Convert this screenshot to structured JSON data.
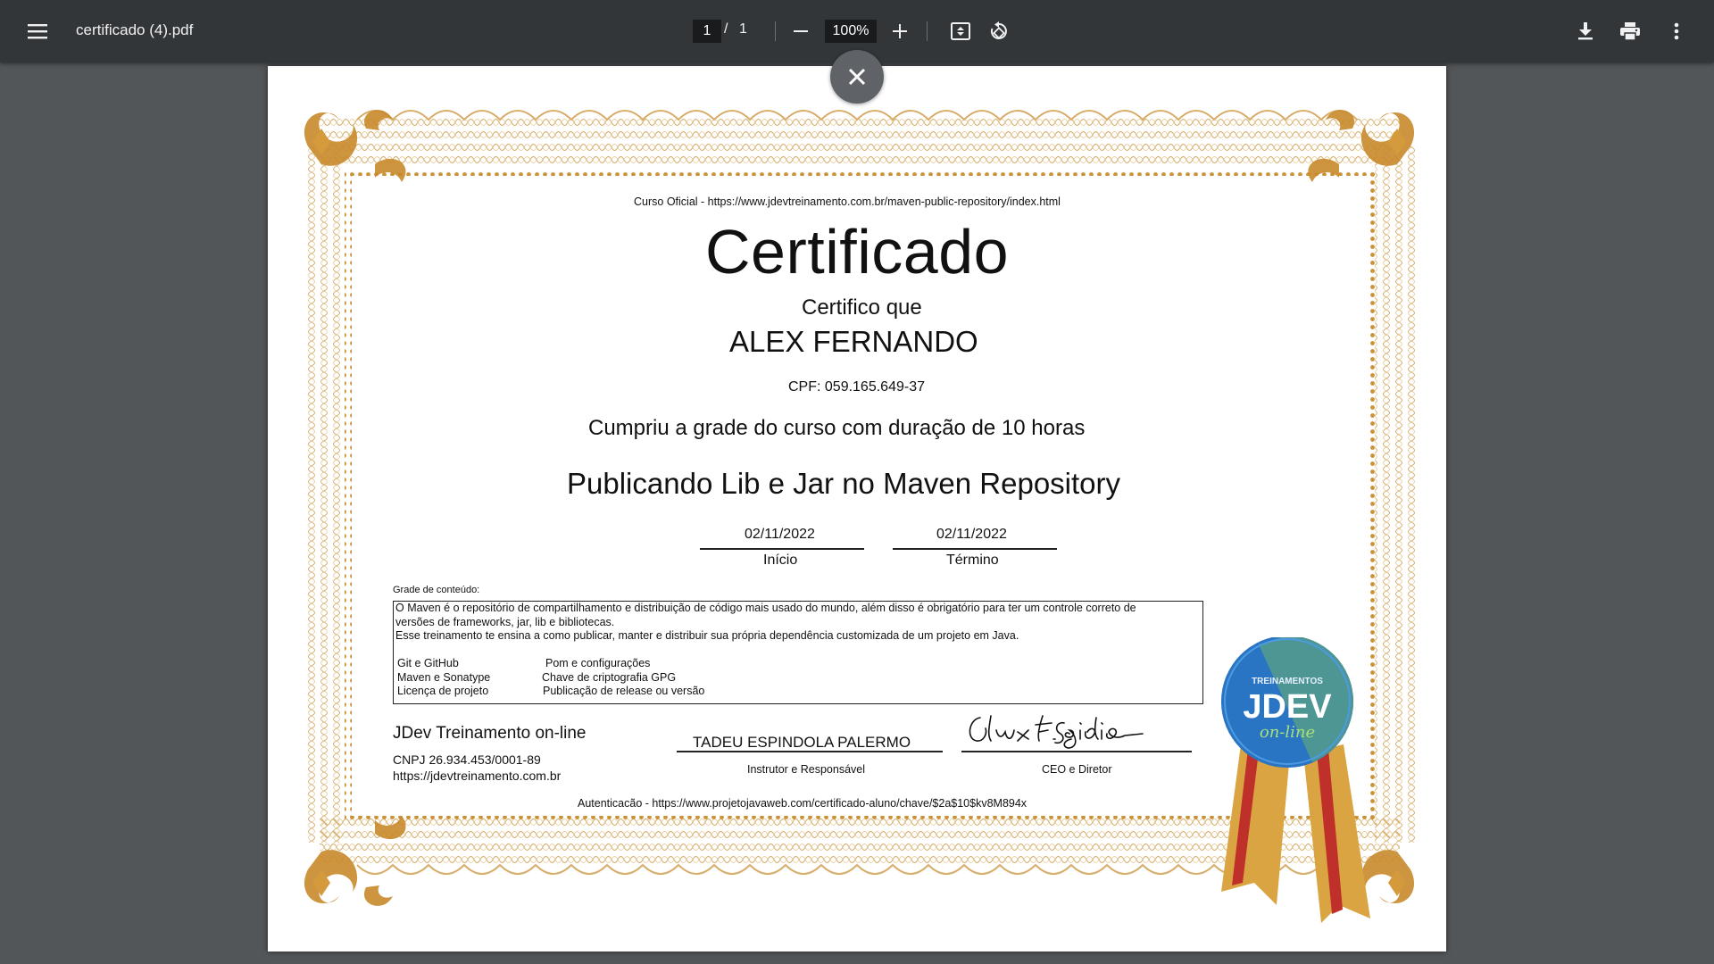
{
  "toolbar": {
    "menu_icon": "hamburger-menu-icon",
    "title": "certificado (4).pdf",
    "page_current": "1",
    "page_separator": "/",
    "page_total": "1",
    "zoom": "100%",
    "icons": [
      "minus-icon",
      "plus-icon",
      "fit-page-icon",
      "rotate-icon",
      "download-icon",
      "print-icon",
      "more-vert-icon"
    ]
  },
  "overlay": {
    "close_icon": "close-icon"
  },
  "certificate": {
    "course_url": "Curso Oficial - https://www.jdevtreinamento.com.br/maven-public-repository/index.html",
    "title": "Certificado",
    "certifico": "Certifico que",
    "student": "ALEX FERNANDO",
    "cpf": "CPF:  059.165.649-37",
    "completion": "Cumpriu a grade do curso com duração de 10 horas",
    "course_name": "Publicando Lib e Jar no Maven Repository",
    "start_date": "02/11/2022",
    "start_label": "Início",
    "end_date": "02/11/2022",
    "end_label": "Término",
    "grade_label": "Grade de conteúdo:",
    "grade_lines": [
      "O Maven é o repositório de compartilhamento e distribuição de código mais usado do mundo, além disso é obrigatório para ter um controle correto de",
      "versões de frameworks, jar, lib e bibliotecas.",
      "Esse treinamento te ensina a como publicar, manter e distribuir sua própria dependência customizada de um projeto em Java."
    ],
    "topics_left": [
      "Git e GitHub",
      "Maven e Sonatype",
      "Licença de projeto"
    ],
    "topics_right": [
      "Pom e configurações",
      "Chave de criptografia GPG",
      "Publicação de release ou versão"
    ],
    "school_name": "JDev Treinamento on-line",
    "cnpj": "CNPJ 26.934.453/0001-89",
    "school_url": "https://jdevtreinamento.com.br",
    "instructor": "TADEU ESPINDOLA PALERMO",
    "instructor_role": "Instrutor e Responsável",
    "ceo_role": "CEO e Diretor",
    "authentication": "Autenticacão - https://www.projetojavaweb.com/certificado-aluno/chave/$2a$10$kv8M894x",
    "seal_top": "TREINAMENTOS",
    "seal_main": "JDEV",
    "seal_sub": "on-line"
  },
  "colors": {
    "toolbar_bg": "#323639",
    "viewer_bg": "#525659",
    "frame_gold": "#c8943c",
    "frame_light": "#e6c27a",
    "seal_blue": "#2a74c4",
    "seal_green": "#7bbf5a",
    "ribbon_red": "#c0302a",
    "ribbon_gold": "#d9a441"
  }
}
